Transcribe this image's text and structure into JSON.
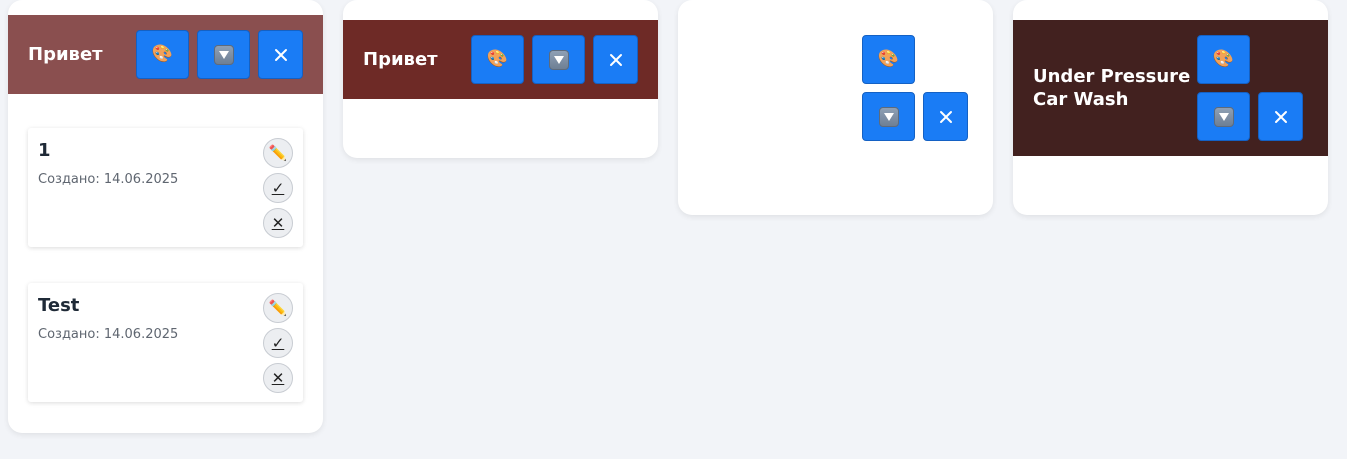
{
  "colors": {
    "page_background": "#f2f4f8",
    "button_blue": "#1a7cf5",
    "board1_header": "#8a4f4f",
    "board2_header": "#6e2a26",
    "board4_header": "#42211f"
  },
  "icons": {
    "palette": "🎨",
    "dropdown": "chevron-down-icon",
    "close": "✕",
    "edit": "✏️",
    "check": "✓",
    "delete": "✕"
  },
  "boards": [
    {
      "title": "Привет",
      "cards": [
        {
          "title": "1",
          "created": "Создано: 14.06.2025"
        },
        {
          "title": "Test",
          "created": "Создано: 14.06.2025"
        }
      ]
    },
    {
      "title": "Привет",
      "cards": []
    },
    {
      "title": "",
      "cards": []
    },
    {
      "title": "Under Pressure Car Wash",
      "cards": []
    }
  ]
}
